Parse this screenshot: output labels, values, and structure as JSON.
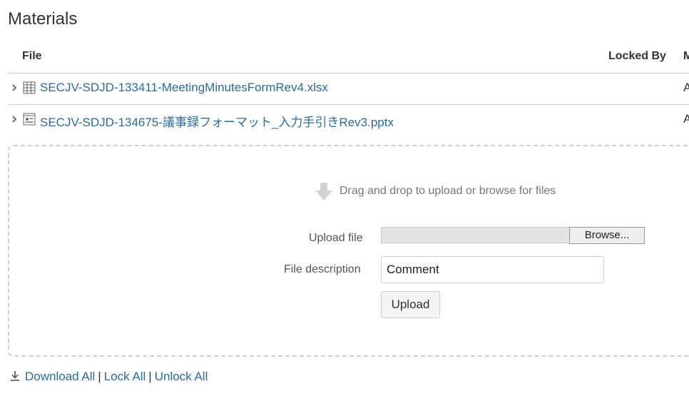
{
  "section_title": "Materials",
  "table": {
    "columns": [
      "File",
      "Locked By",
      "M"
    ],
    "rows": [
      {
        "filename": "SECJV-SDJD-133411-MeetingMinutesFormRev4.xlsx",
        "icon": "spreadsheet-icon",
        "trailing": "A"
      },
      {
        "filename": "SECJV-SDJD-134675-議事録フォーマット_入力手引きRev3.pptx",
        "icon": "presentation-icon",
        "trailing": "A"
      }
    ]
  },
  "dropzone": {
    "hint": "Drag and drop to upload or browse for files",
    "upload_file_label": "Upload file",
    "browse_label": "Browse...",
    "file_description_label": "File description",
    "description_value": "Comment",
    "upload_label": "Upload"
  },
  "actions": {
    "download_all": "Download All",
    "lock_all": "Lock All",
    "unlock_all": "Unlock All",
    "separator": "|"
  },
  "colors": {
    "link": "#2b6a9e",
    "text": "#333333",
    "border": "#cccccc"
  }
}
